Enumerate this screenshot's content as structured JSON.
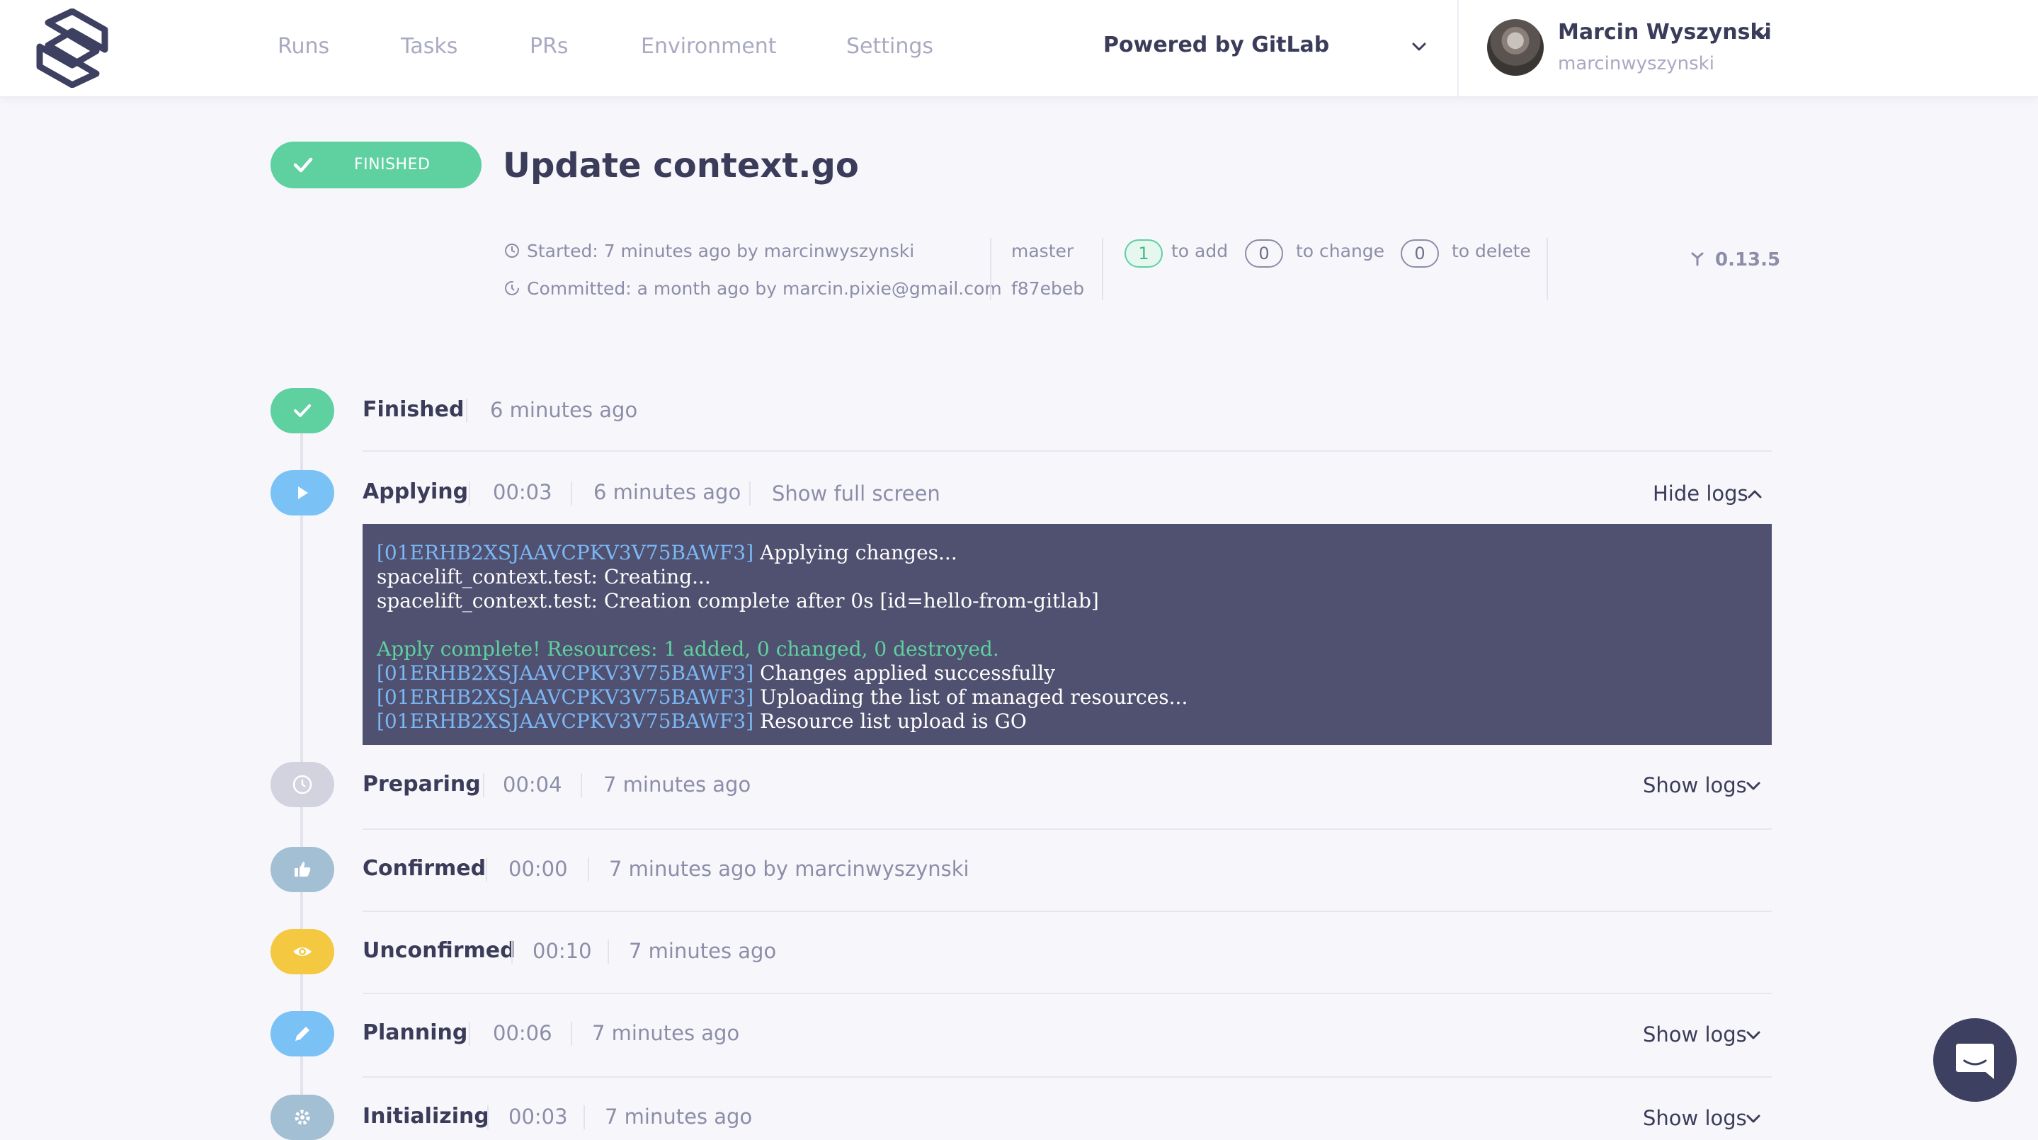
{
  "nav": {
    "items": [
      "Runs",
      "Tasks",
      "PRs",
      "Environment",
      "Settings"
    ],
    "environment_select": "Powered by GitLab"
  },
  "user": {
    "name": "Marcin Wyszynski",
    "handle": "marcinwyszynski"
  },
  "run": {
    "status": "FINISHED",
    "title": "Update context.go",
    "started": "Started: 7 minutes ago by marcinwyszynski",
    "committed": "Committed: a month ago by marcin.pixie@gmail.com",
    "branch": "master",
    "commit": "f87ebeb",
    "changes": {
      "add_count": "1",
      "add_label": "to add",
      "change_count": "0",
      "change_label": "to change",
      "delete_count": "0",
      "delete_label": "to delete"
    },
    "version": "0.13.5"
  },
  "steps": [
    {
      "name": "Finished",
      "duration": "",
      "time": "6 minutes ago",
      "color": "#5fd0a0",
      "icon": "check-icon"
    },
    {
      "name": "Applying",
      "duration": "00:03",
      "time": "6 minutes ago",
      "extra": "Show full screen",
      "logs_toggle": "Hide logs",
      "color": "#7ac1f5",
      "icon": "play-icon"
    },
    {
      "name": "Preparing",
      "duration": "00:04",
      "time": "7 minutes ago",
      "logs_toggle": "Show logs",
      "color": "#d3d3e0",
      "icon": "clock-icon"
    },
    {
      "name": "Confirmed",
      "duration": "00:00",
      "time": "7 minutes ago by marcinwyszynski",
      "color": "#a3bfd3",
      "icon": "thumbs-up-icon"
    },
    {
      "name": "Unconfirmed",
      "duration": "00:10",
      "time": "7 minutes ago",
      "color": "#f5c842",
      "icon": "eye-icon"
    },
    {
      "name": "Planning",
      "duration": "00:06",
      "time": "7 minutes ago",
      "logs_toggle": "Show logs",
      "color": "#7ac1f5",
      "icon": "pencil-icon"
    },
    {
      "name": "Initializing",
      "duration": "00:03",
      "time": "7 minutes ago",
      "logs_toggle": "Show logs",
      "color": "#a3bfd3",
      "icon": "gear-icon"
    }
  ],
  "logs": {
    "run_id": "[01ERHB2XSJAAVCPKV3V75BAWF3]",
    "line1": " Applying changes...",
    "line2": "spacelift_context.test: Creating...",
    "line3": "spacelift_context.test: Creation complete after 0s [id=hello-from-gitlab]",
    "line4": "Apply complete! Resources: 1 added, 0 changed, 0 destroyed.",
    "line5": " Changes applied successfully",
    "line6": " Uploading the list of managed resources...",
    "line7": " Resource list upload is GO"
  }
}
